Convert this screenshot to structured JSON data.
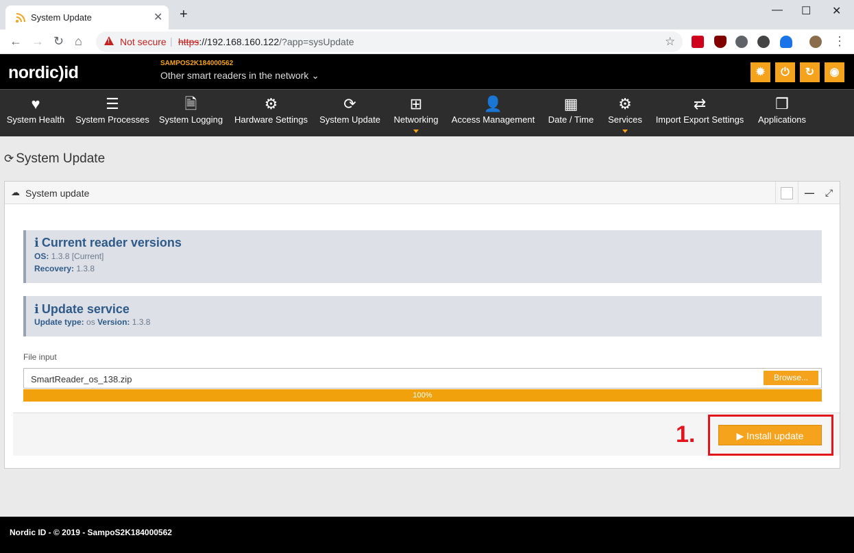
{
  "browser": {
    "tab_title": "System Update",
    "new_tab": "+",
    "tab_close": "✕",
    "not_secure": "Not secure",
    "separator": "|",
    "url_scheme": "https",
    "url_host": "://192.168.160.122",
    "url_path": "/?app=sysUpdate",
    "window_controls": {
      "minimize": "—",
      "maximize": "☐",
      "close": "✕"
    },
    "nav": {
      "back": "←",
      "forward": "→",
      "reload": "↻",
      "home": "⌂"
    }
  },
  "header": {
    "logo": "nordic)id",
    "reader_id": "SAMPOS2K184000562",
    "other_readers": "Other smart readers in the network ⌄",
    "buttons": [
      {
        "icon": "bug-icon",
        "glyph": "✹"
      },
      {
        "icon": "power-icon",
        "glyph": "⏻"
      },
      {
        "icon": "refresh-icon",
        "glyph": "↻"
      },
      {
        "icon": "target-icon",
        "glyph": "◉"
      }
    ]
  },
  "nav": [
    {
      "label": "System Health",
      "icon": "heartbeat-icon",
      "glyph": "♥"
    },
    {
      "label": "System Processes",
      "icon": "list-icon",
      "glyph": "☰"
    },
    {
      "label": "System Logging",
      "icon": "file-icon",
      "glyph": "🗎"
    },
    {
      "label": "Hardware Settings",
      "icon": "gears-icon",
      "glyph": "⚙"
    },
    {
      "label": "System Update",
      "icon": "refresh-icon",
      "glyph": "⟳"
    },
    {
      "label": "Networking",
      "icon": "sitemap-icon",
      "glyph": "⊞"
    },
    {
      "label": "Access Management",
      "icon": "user-icon",
      "glyph": "👤"
    },
    {
      "label": "Date / Time",
      "icon": "calendar-icon",
      "glyph": "▦"
    },
    {
      "label": "Services",
      "icon": "gear-icon",
      "glyph": "⚙"
    },
    {
      "label": "Import Export Settings",
      "icon": "exchange-icon",
      "glyph": "⇄"
    },
    {
      "label": "Applications",
      "icon": "cubes-icon",
      "glyph": "❒"
    }
  ],
  "page": {
    "title": "System Update",
    "title_icon": "⟳",
    "panel_title": "System update",
    "panel_icon": "☁",
    "panel_ctl": {
      "minimize": "—",
      "expand": "⤢"
    },
    "versions": {
      "heading": "Current reader versions",
      "info_glyph": "i",
      "os_label": "OS:",
      "os_value": "1.3.8 [Current]",
      "recovery_label": "Recovery:",
      "recovery_value": "1.3.8"
    },
    "service": {
      "heading": "Update service",
      "info_glyph": "i",
      "type_label": "Update type:",
      "type_value": "os",
      "version_label": "Version:",
      "version_value": "1.3.8"
    },
    "file_input_label": "File input",
    "file_name": "SmartReader_os_138.zip",
    "browse_label": "Browse...",
    "progress": 1.0,
    "progress_text": "100%",
    "step_label": "1.",
    "install_label": "▶ Install update"
  },
  "footer": {
    "text": "Nordic ID - © 2019 - SampoS2K184000562"
  },
  "colors": {
    "accent": "#f5a21c",
    "highlight": "#e3141b",
    "nav_bg": "#2d2d2d"
  }
}
